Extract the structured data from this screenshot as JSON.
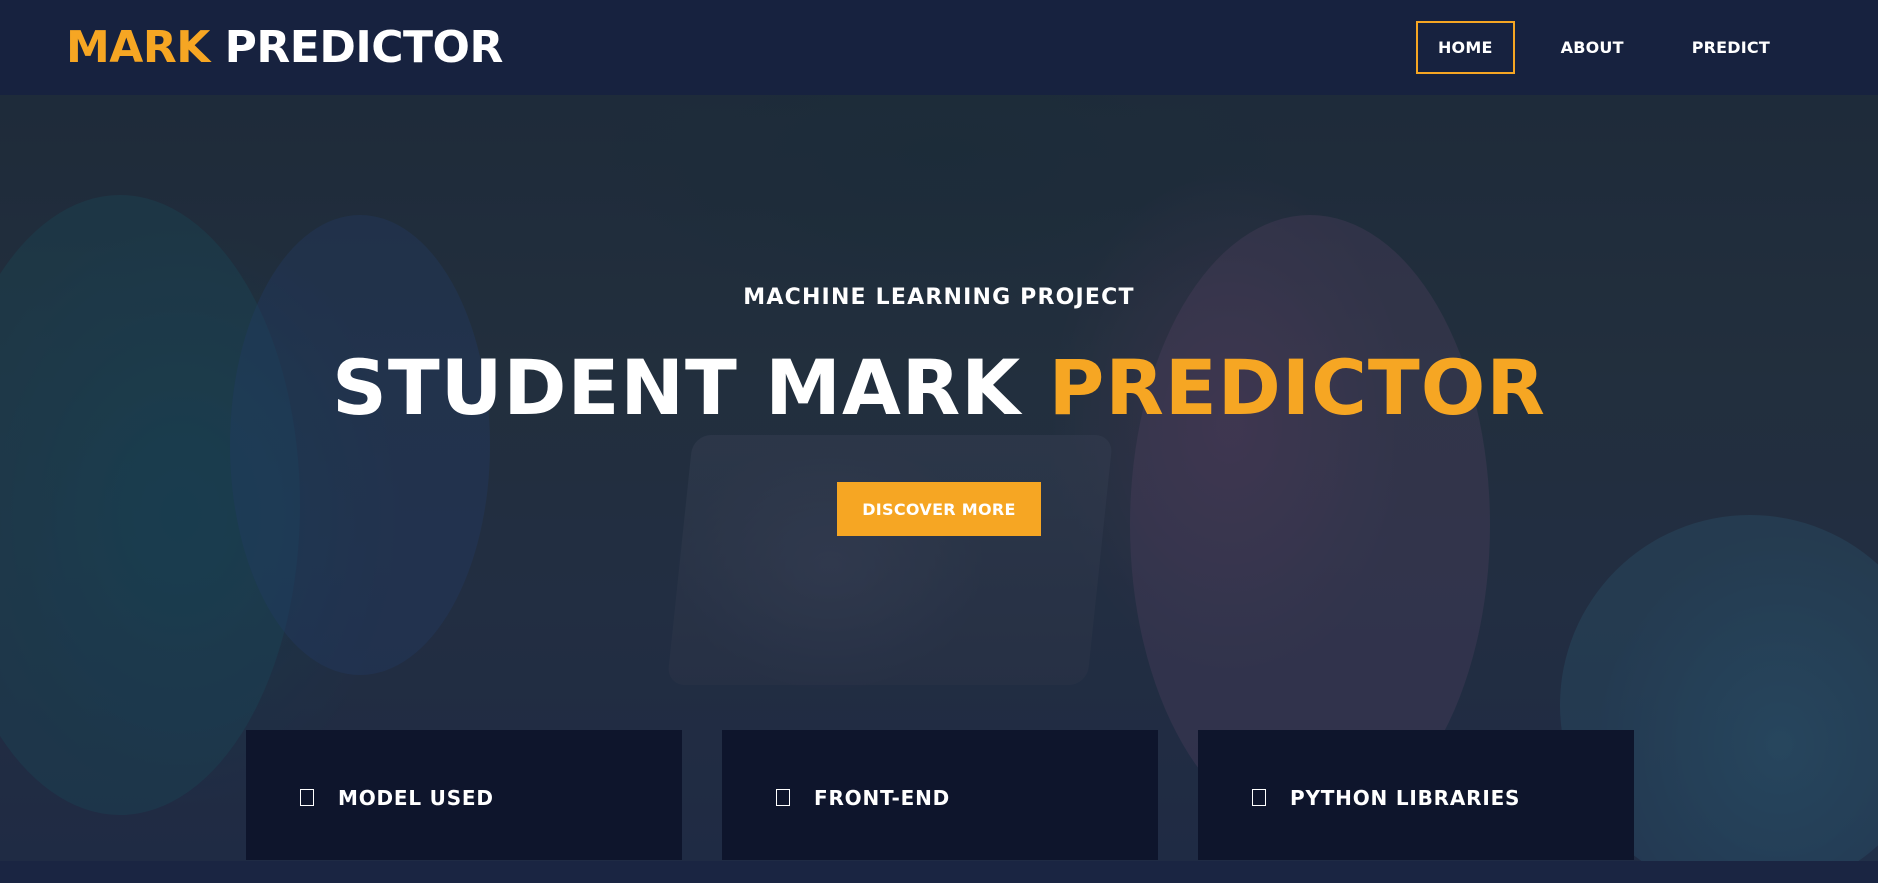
{
  "brand": {
    "accent": "MARK",
    "rest": "PREDICTOR"
  },
  "nav": {
    "items": [
      {
        "label": "HOME",
        "active": true
      },
      {
        "label": "ABOUT",
        "active": false
      },
      {
        "label": "PREDICT",
        "active": false
      }
    ]
  },
  "hero": {
    "eyebrow": "MACHINE LEARNING PROJECT",
    "headline_plain": "STUDENT MARK ",
    "headline_accent": "PREDICTOR",
    "cta_label": "DISCOVER MORE"
  },
  "cards": [
    {
      "icon": "square-icon",
      "label": "MODEL USED"
    },
    {
      "icon": "square-icon",
      "label": "FRONT-END"
    },
    {
      "icon": "square-icon",
      "label": "PYTHON LIBRARIES"
    }
  ],
  "colors": {
    "accent": "#f6a623",
    "navbar": "#17223f",
    "card": "#0e152c",
    "text": "#ffffff"
  }
}
